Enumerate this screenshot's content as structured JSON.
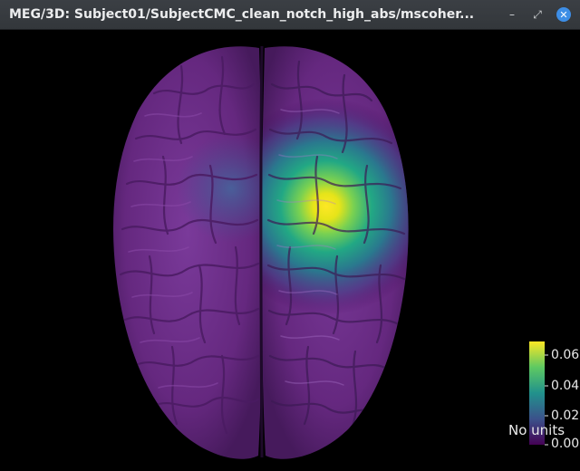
{
  "window": {
    "title": "MEG/3D: Subject01/SubjectCMC_clean_notch_high_abs/mscoher...",
    "minimize_glyph": "–",
    "restore_glyph": "⤢",
    "close_glyph": "✕"
  },
  "colorbar": {
    "labels": [
      "0.06",
      "0.04",
      "0.02",
      "0.00"
    ],
    "units": "No units",
    "colormap": [
      "#fde725",
      "#5ec962",
      "#21918c",
      "#3b528b",
      "#440154"
    ]
  },
  "icons": {
    "minimize": "minimize-icon",
    "restore": "restore-icon",
    "close": "close-icon"
  }
}
